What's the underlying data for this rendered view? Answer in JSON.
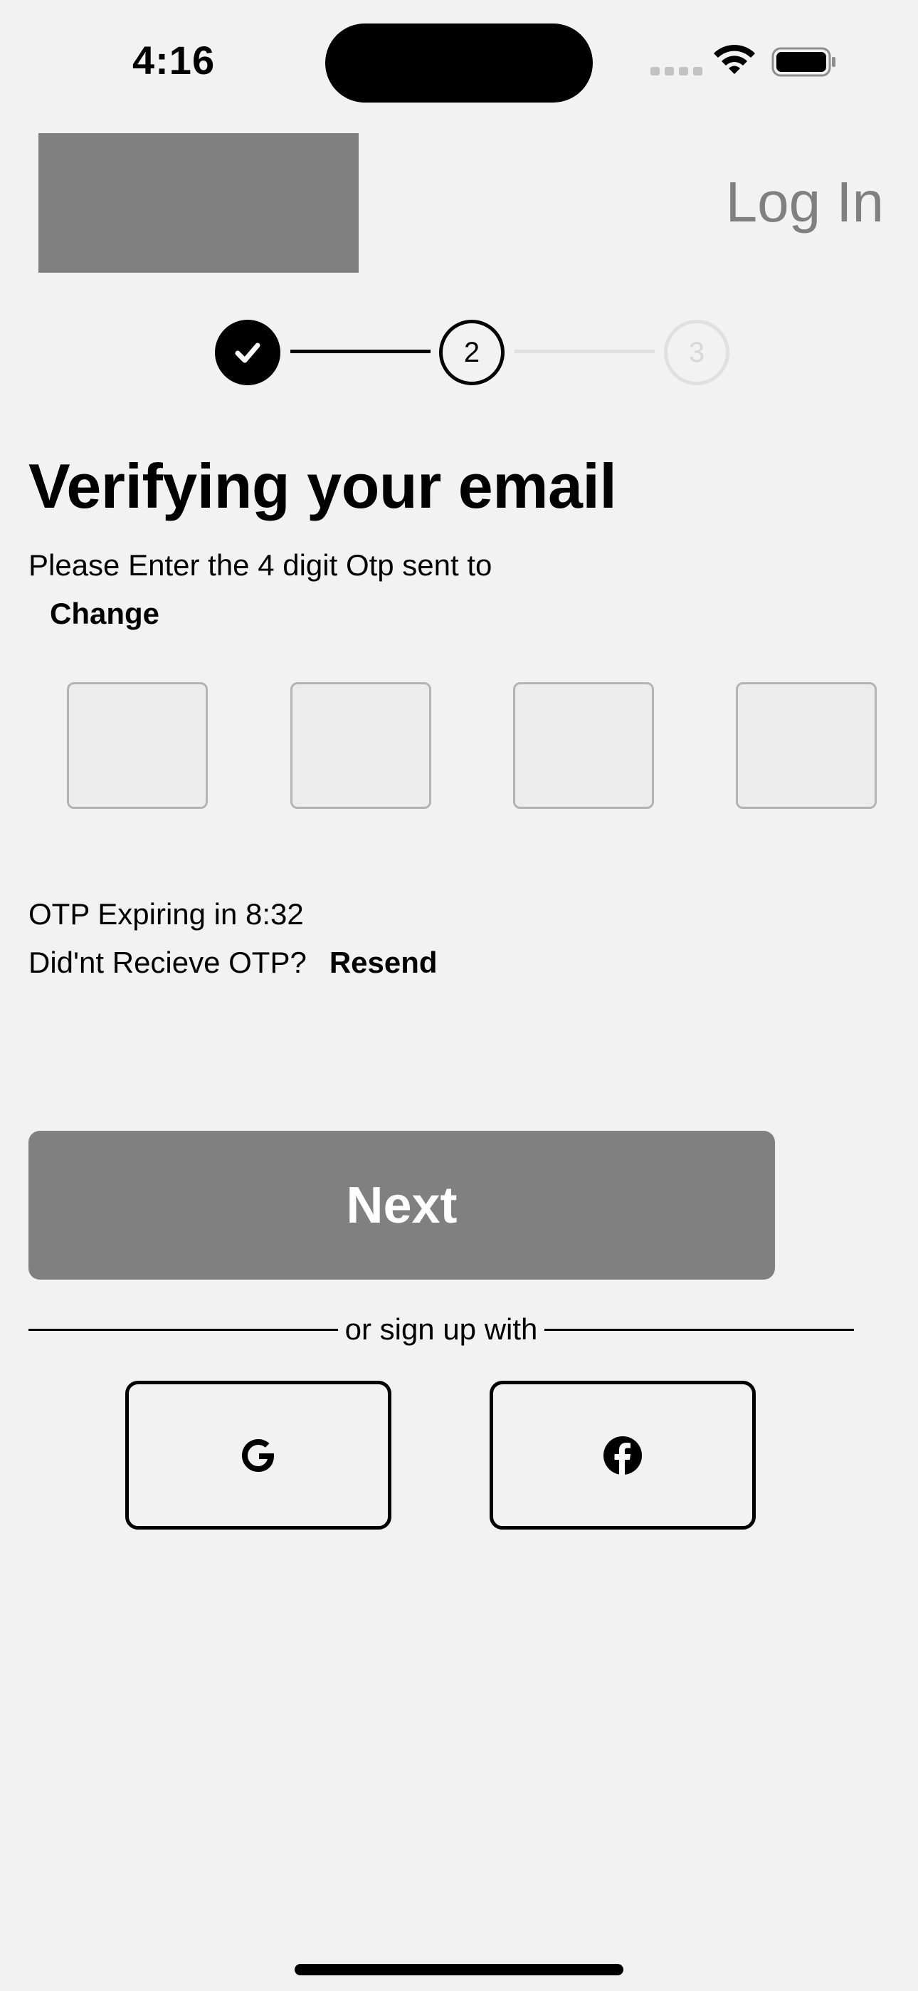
{
  "status_bar": {
    "time": "4:16"
  },
  "header": {
    "login_label": "Log In"
  },
  "stepper": {
    "step2": "2",
    "step3": "3",
    "current_step": 2
  },
  "verify": {
    "heading": "Verifying your email",
    "subtext": "Please Enter the 4 digit Otp sent to",
    "change_label": "Change",
    "otp_values": [
      "",
      "",
      "",
      ""
    ]
  },
  "otp_status": {
    "expiry": "OTP Expiring in 8:32",
    "not_received": "Did'nt Recieve OTP?",
    "resend_label": "Resend"
  },
  "actions": {
    "next_label": "Next",
    "divider_text": "or sign up with"
  },
  "social": {
    "google_icon": "google-icon",
    "facebook_icon": "facebook-icon"
  },
  "colors": {
    "background": "#f2f2f2",
    "placeholder_gray": "#808080",
    "accent": "#000000",
    "inactive_step": "#e0e0e0"
  }
}
